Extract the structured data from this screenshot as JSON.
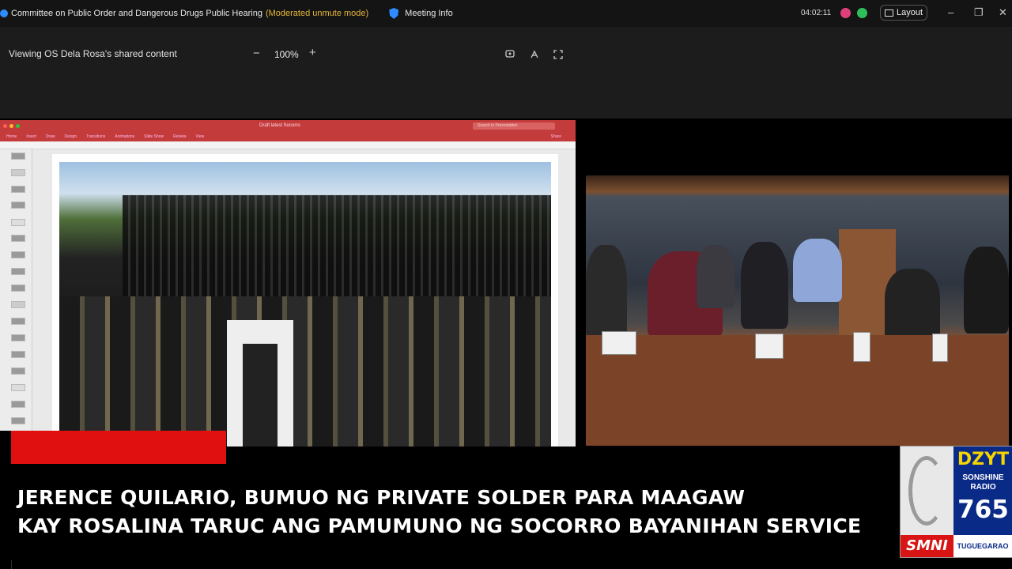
{
  "titlebar": {
    "title": "Committee on Public Order and Dangerous Drugs Public Hearing",
    "mode": "(Moderated unmute mode)",
    "meeting_info": "Meeting Info",
    "time": "04:02:11",
    "layout_label": "Layout",
    "minimize": "–",
    "restore": "❐",
    "close": "✕"
  },
  "share_bar": {
    "viewing_text": "Viewing OS Dela Rosa's shared content",
    "zoom_minus": "−",
    "zoom_level": "100%",
    "zoom_plus": "+"
  },
  "ppt": {
    "doc_title": "Draft latest Socorro",
    "search_placeholder": "Search in Presentation",
    "ribbon_tabs": [
      "Home",
      "Insert",
      "Draw",
      "Design",
      "Transitions",
      "Animations",
      "Slide Show",
      "Review",
      "View"
    ],
    "share_label": "Share"
  },
  "lower_third": {
    "line1": "JERENCE QUILARIO, BUMUO NG PRIVATE SOLDER PARA MAAGAW",
    "line2": "KAY ROSALINA TARUC ANG PAMUMUNO NG SOCORRO BAYANIHAN SERVICE"
  },
  "station_logo": {
    "call_sign": "DZYT",
    "tagline_1": "SONSHINE",
    "tagline_2": "RADIO",
    "frequency": "765",
    "network": "SMNI",
    "city": "TUGUEGARAO"
  },
  "colors": {
    "ticker_red": "#e01010",
    "mode_yellow": "#e4b63a",
    "logo_blue": "#0a2a88",
    "logo_yellow": "#f5d400"
  }
}
